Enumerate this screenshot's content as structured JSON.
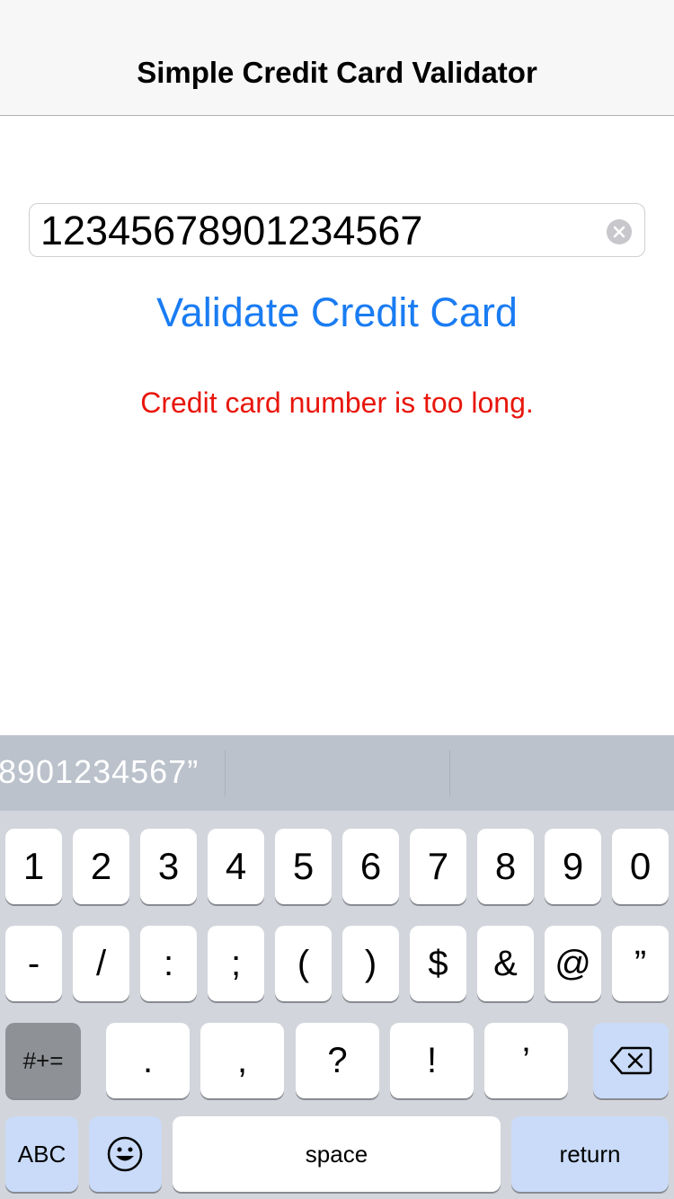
{
  "nav": {
    "title": "Simple Credit Card Validator"
  },
  "card_input": {
    "value": "12345678901234567",
    "placeholder": ""
  },
  "validate_label": "Validate Credit Card",
  "error_message": "Credit card number is too long.",
  "suggestion": {
    "text": "8901234567”"
  },
  "keyboard": {
    "row1": [
      "1",
      "2",
      "3",
      "4",
      "5",
      "6",
      "7",
      "8",
      "9",
      "0"
    ],
    "row2": [
      "-",
      "/",
      ":",
      ";",
      "(",
      ")",
      "$",
      "&",
      "@",
      "”"
    ],
    "row3": [
      ".",
      ",",
      "?",
      "!",
      "’"
    ],
    "more_symbols_label": "#+=",
    "abc_label": "ABC",
    "space_label": "space",
    "return_label": "return"
  },
  "colors": {
    "accent": "#1a7cf3",
    "error": "#e8160c"
  }
}
